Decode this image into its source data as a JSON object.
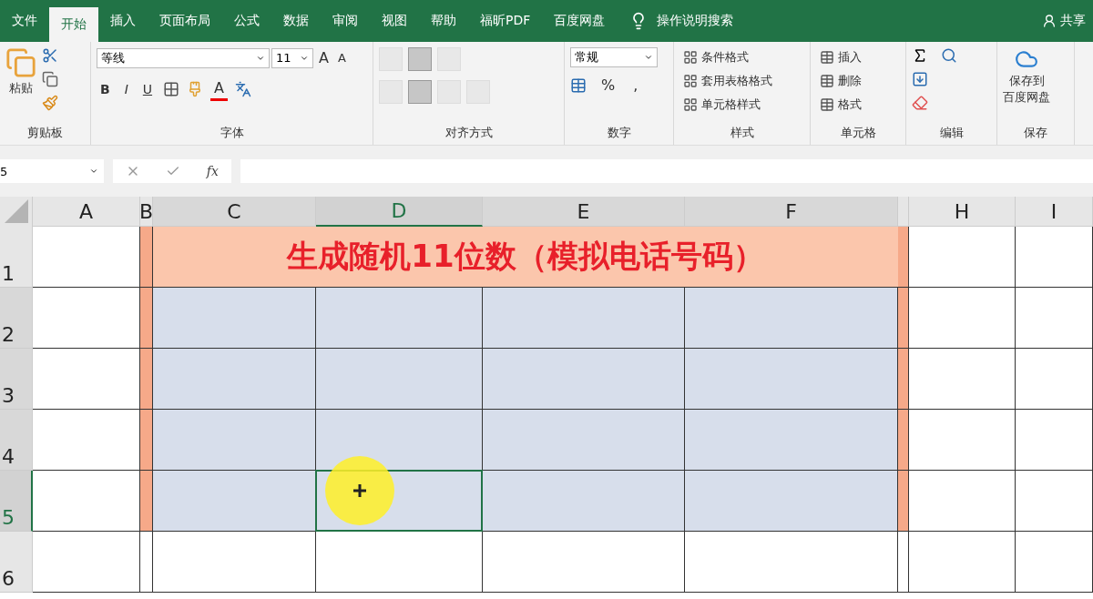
{
  "tabs": [
    {
      "label": "文件",
      "selected": false
    },
    {
      "label": "开始",
      "selected": true
    },
    {
      "label": "插入",
      "selected": false
    },
    {
      "label": "页面布局",
      "selected": false
    },
    {
      "label": "公式",
      "selected": false
    },
    {
      "label": "数据",
      "selected": false
    },
    {
      "label": "审阅",
      "selected": false
    },
    {
      "label": "视图",
      "selected": false
    },
    {
      "label": "帮助",
      "selected": false
    },
    {
      "label": "福昕PDF",
      "selected": false
    },
    {
      "label": "百度网盘",
      "selected": false
    }
  ],
  "search": {
    "label": "操作说明搜索"
  },
  "share": {
    "label": "共享"
  },
  "ribbon": {
    "clipboard": {
      "paste": "粘贴",
      "title": "剪贴板"
    },
    "font": {
      "name": "等线",
      "size": "11",
      "grow": "A",
      "shrink": "A",
      "styles": [
        "B",
        "I",
        "U"
      ],
      "color_letter": "A",
      "title": "字体"
    },
    "alignment": {
      "title": "对齐方式"
    },
    "number": {
      "format": "常规",
      "symbols": [
        "%",
        ","
      ],
      "title": "数字"
    },
    "styles": {
      "items": [
        "条件格式",
        "套用表格格式",
        "单元格样式"
      ],
      "title": "样式"
    },
    "cells": {
      "items": [
        "插入",
        "删除",
        "格式"
      ],
      "title": "单元格"
    },
    "editing": {
      "title": "编辑"
    },
    "save": {
      "lines": [
        "保存到",
        "百度网盘"
      ],
      "title": "保存"
    }
  },
  "formula_bar": {
    "name_box": "5",
    "fx": "fx"
  },
  "sheet": {
    "columns": [
      {
        "label": "A",
        "selected": false,
        "highlighted": false
      },
      {
        "label": "B",
        "selected": false,
        "highlighted": false,
        "color": "#f6a989"
      },
      {
        "label": "C",
        "selected": false,
        "highlighted": true
      },
      {
        "label": "D",
        "selected": true,
        "highlighted": true
      },
      {
        "label": "E",
        "selected": false,
        "highlighted": true
      },
      {
        "label": "F",
        "selected": false,
        "highlighted": true
      },
      {
        "selected": false,
        "highlighted": false,
        "color": "#f6a989"
      },
      {
        "label": "H",
        "selected": false,
        "highlighted": false
      },
      {
        "label": "I",
        "selected": false,
        "highlighted": false
      }
    ],
    "rows": [
      {
        "label": "1",
        "selected": false,
        "highlighted": false,
        "kind": "title"
      },
      {
        "label": "2",
        "selected": false,
        "highlighted": true,
        "kind": "data"
      },
      {
        "label": "3",
        "selected": false,
        "highlighted": true,
        "kind": "data"
      },
      {
        "label": "4",
        "selected": false,
        "highlighted": true,
        "kind": "data"
      },
      {
        "label": "5",
        "selected": true,
        "highlighted": true,
        "kind": "data"
      },
      {
        "label": "6",
        "selected": false,
        "highlighted": false,
        "kind": "blank"
      }
    ],
    "title": "生成随机11位数（模拟电话号码）"
  }
}
